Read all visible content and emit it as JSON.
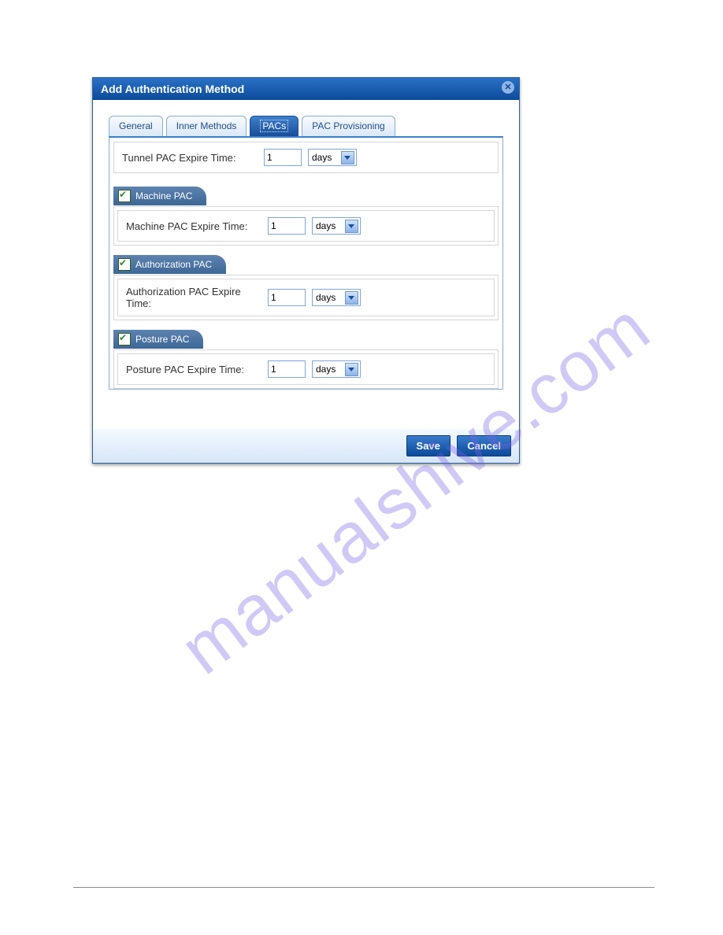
{
  "dialog": {
    "title": "Add Authentication Method"
  },
  "tabs": {
    "general": "General",
    "inner": "Inner Methods",
    "pacs": "PACs",
    "prov": "PAC Provisioning"
  },
  "tunnel": {
    "label": "Tunnel PAC Expire Time:",
    "value": "1",
    "unit": "days"
  },
  "machine": {
    "header": "Machine PAC",
    "label": "Machine PAC Expire Time:",
    "value": "1",
    "unit": "days"
  },
  "auth": {
    "header": "Authorization PAC",
    "label": "Authorization PAC Expire Time:",
    "value": "1",
    "unit": "days"
  },
  "posture": {
    "header": "Posture PAC",
    "label": "Posture PAC Expire Time:",
    "value": "1",
    "unit": "days"
  },
  "buttons": {
    "save": "Save",
    "cancel": "Cancel"
  },
  "watermark": "manualshive.com"
}
